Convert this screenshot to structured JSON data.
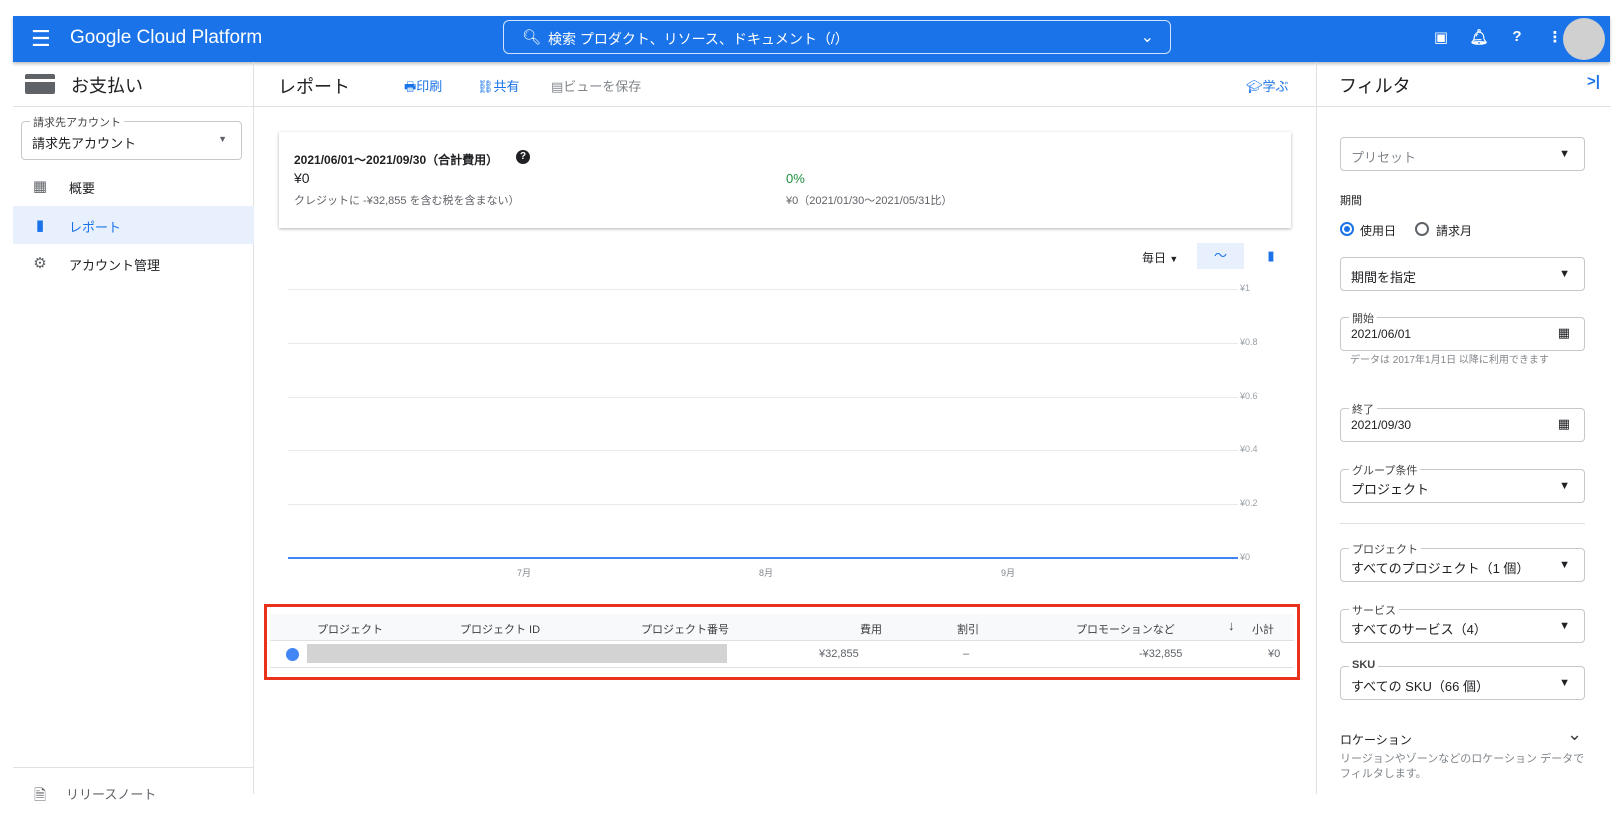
{
  "header": {
    "brand": "Google Cloud Platform",
    "search_icon": "search-icon",
    "search_placeholder": "検索  プロダクト、リソース、ドキュメント（/）",
    "icons": [
      "cloud-shell-icon",
      "bell-icon",
      "help-icon",
      "more-vert-icon"
    ],
    "accent": "#1a73e8"
  },
  "sidebar": {
    "title": "お支払い",
    "account_label": "請求先アカウント",
    "account_value": "請求先アカウント",
    "items": [
      {
        "label": "概要",
        "icon": "dashboard-icon"
      },
      {
        "label": "レポート",
        "icon": "bar-chart-icon",
        "active": true
      },
      {
        "label": "アカウント管理",
        "icon": "gear-icon"
      }
    ],
    "footer": "リリースノート"
  },
  "toolbar": {
    "title": "レポート",
    "print": "印刷",
    "share": "共有",
    "save_view": "ビューを保存",
    "learn": "学ぶ"
  },
  "summary": {
    "range": "2021/06/01～2021/09/30（合計費用）",
    "total": "¥0",
    "note": "クレジットに -¥32,855 を含む税を含まない）",
    "change": "0%",
    "change_color": "#1e8e3e",
    "compare": "¥0（2021/01/30～2021/05/31比）"
  },
  "chart_controls": {
    "granularity": "毎日",
    "mode": "line"
  },
  "chart_data": {
    "type": "line",
    "y_ticks": [
      "¥1",
      "¥0.8",
      "¥0.6",
      "¥0.4",
      "¥0.2",
      "¥0"
    ],
    "ylim": [
      0,
      1
    ],
    "x_ticks": [
      "7月",
      "8月",
      "9月"
    ],
    "x_range": [
      "2021/06/01",
      "2021/09/30"
    ],
    "series": [
      {
        "values": [
          0,
          0
        ]
      }
    ],
    "grid": true
  },
  "table": {
    "headers": [
      "プロジェクト",
      "プロジェクト ID",
      "プロジェクト番号",
      "費用",
      "割引",
      "プロモーションなど",
      "小計"
    ],
    "sort_icon": "arrow-down-icon",
    "rows": [
      {
        "cost": "¥32,855",
        "discount": "–",
        "promotion": "-¥32,855",
        "subtotal": "¥0",
        "color": "#4285f4"
      }
    ]
  },
  "filters": {
    "title": "フィルタ",
    "preset": "プリセット",
    "period_label": "期間",
    "radio_usage": "使用日",
    "radio_invoice": "請求月",
    "period_select": "期間を指定",
    "start_label": "開始",
    "start": "2021/06/01",
    "helper": "データは 2017年1月1日 以降に利用できます",
    "end_label": "終了",
    "end": "2021/09/30",
    "group_label": "グループ条件",
    "group": "プロジェクト",
    "project_label": "プロジェクト",
    "project": "すべてのプロジェクト（1 個）",
    "service_label": "サービス",
    "service": "すべてのサービス（4）",
    "sku_label": "SKU",
    "sku": "すべての SKU（66 個）",
    "location": "ロケーション",
    "location_desc": "リージョンやゾーンなどのロケーション データでフィルタします。"
  }
}
